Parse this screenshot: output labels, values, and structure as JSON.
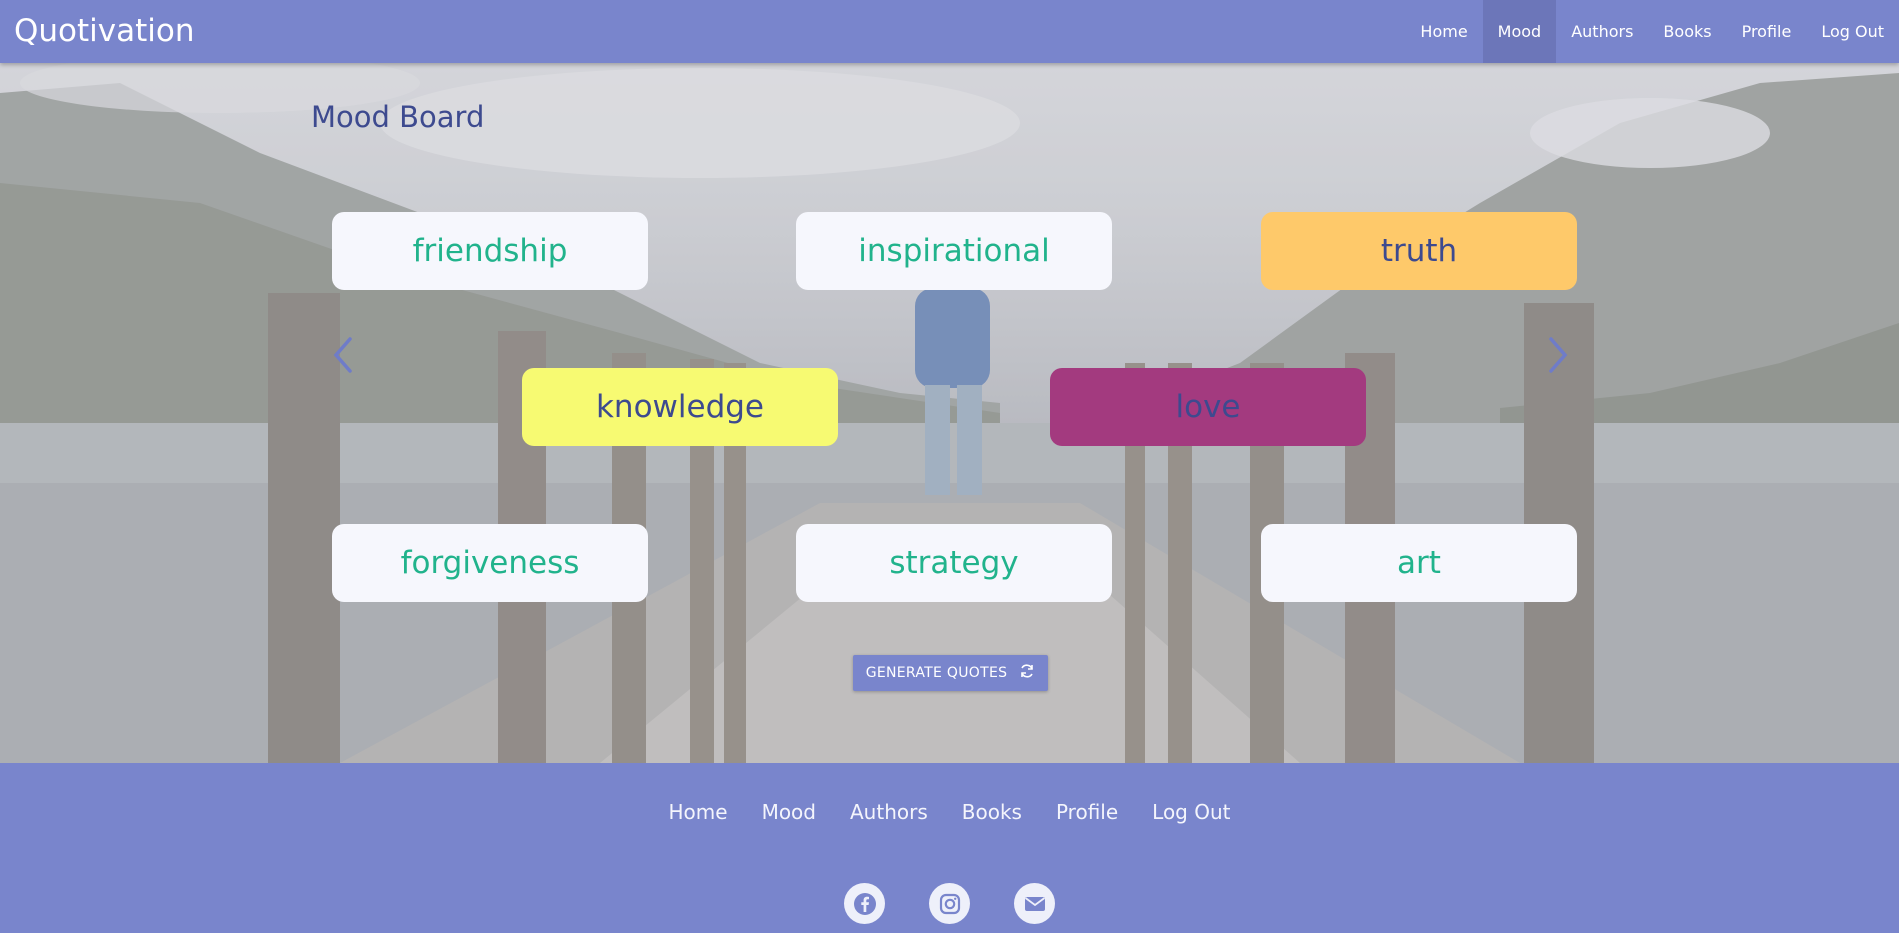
{
  "navbar": {
    "brand": "Quotivation",
    "links": [
      "Home",
      "Mood",
      "Authors",
      "Books",
      "Profile",
      "Log Out"
    ],
    "active": "Mood"
  },
  "mood_board": {
    "title": "Mood Board",
    "moods": [
      {
        "label": "friendship",
        "selected": false
      },
      {
        "label": "inspirational",
        "selected": false
      },
      {
        "label": "truth",
        "selected": true,
        "color": "#fec96a"
      },
      {
        "label": "knowledge",
        "selected": true,
        "color": "#f7fa72"
      },
      {
        "label": "love",
        "selected": true,
        "color": "#a33a7f"
      },
      {
        "label": "forgiveness",
        "selected": false
      },
      {
        "label": "strategy",
        "selected": false
      },
      {
        "label": "art",
        "selected": false
      }
    ],
    "prev_icon": "chevron-left-icon",
    "next_icon": "chevron-right-icon",
    "generate_button": "GENERATE QUOTES",
    "generate_icon": "refresh-icon"
  },
  "footer": {
    "links": [
      "Home",
      "Mood",
      "Authors",
      "Books",
      "Profile",
      "Log Out"
    ],
    "social": [
      "facebook-icon",
      "instagram-icon",
      "mail-icon"
    ]
  },
  "colors": {
    "primary": "#7985cc",
    "title": "#3d4a8f",
    "card_text": "#21b38c",
    "card_bg": "#f6f7fd"
  }
}
